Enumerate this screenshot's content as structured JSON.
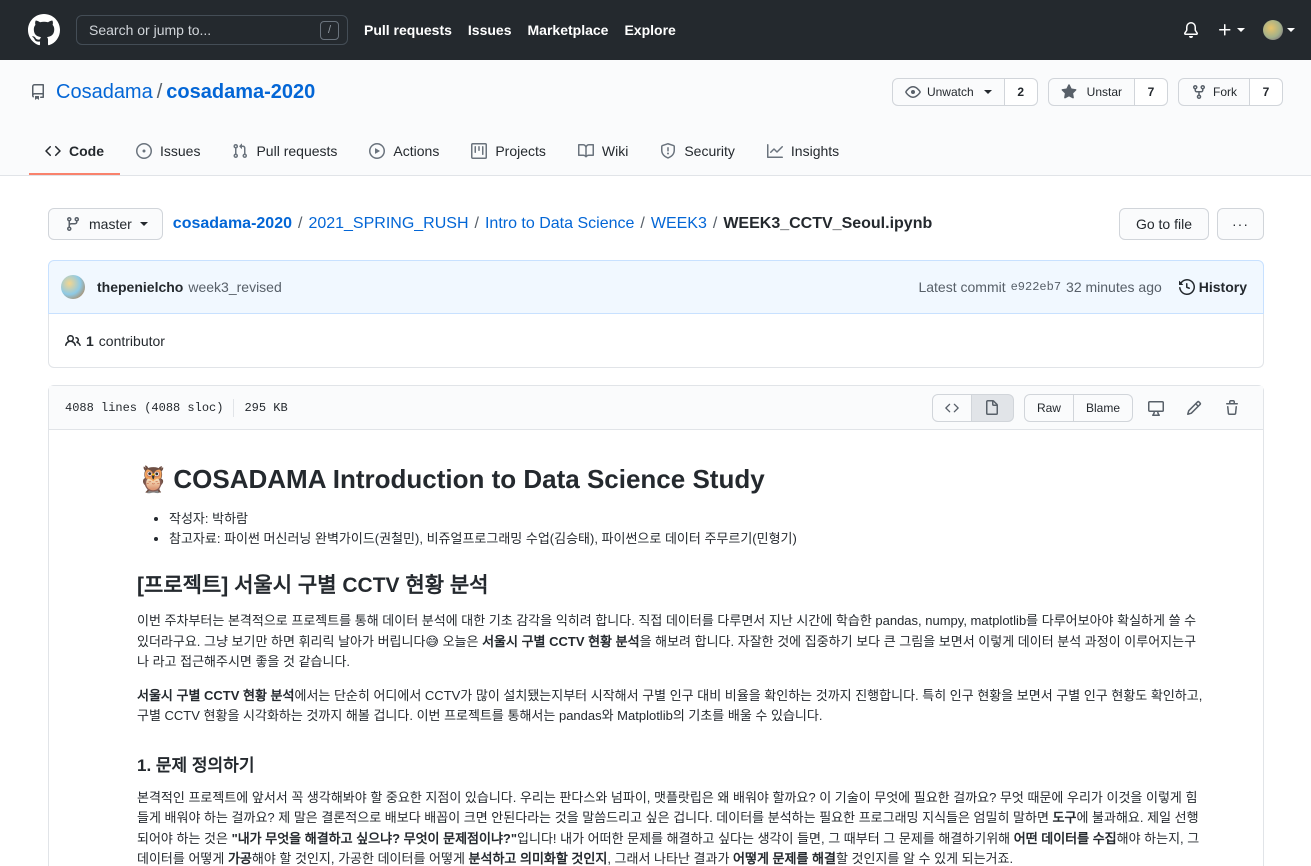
{
  "topbar": {
    "search_placeholder": "Search or jump to...",
    "search_shortcut": "/",
    "nav": [
      "Pull requests",
      "Issues",
      "Marketplace",
      "Explore"
    ]
  },
  "repo": {
    "owner": "Cosadama",
    "separator": "/",
    "name": "cosadama-2020",
    "watch_label": "Unwatch",
    "watch_count": "2",
    "star_label": "Unstar",
    "star_count": "7",
    "fork_label": "Fork",
    "fork_count": "7"
  },
  "tabs": [
    {
      "label": "Code",
      "icon": "code-icon"
    },
    {
      "label": "Issues",
      "icon": "issue-icon"
    },
    {
      "label": "Pull requests",
      "icon": "pull-request-icon"
    },
    {
      "label": "Actions",
      "icon": "play-icon"
    },
    {
      "label": "Projects",
      "icon": "project-icon"
    },
    {
      "label": "Wiki",
      "icon": "book-icon"
    },
    {
      "label": "Security",
      "icon": "shield-icon"
    },
    {
      "label": "Insights",
      "icon": "graph-icon"
    }
  ],
  "filenav": {
    "branch": "master",
    "crumbs": [
      "cosadama-2020",
      "2021_SPRING_RUSH",
      "Intro to Data Science",
      "WEEK3"
    ],
    "current_file": "WEEK3_CCTV_Seoul.ipynb",
    "goto_label": "Go to file",
    "more_label": "···"
  },
  "commit": {
    "author": "thepenielcho",
    "message": "week3_revised",
    "latest_label": "Latest commit",
    "sha": "e922eb7",
    "time": "32 minutes ago",
    "history_label": "History"
  },
  "contributors": {
    "count": "1",
    "label": "contributor"
  },
  "file": {
    "lines": "4088 lines (4088 sloc)",
    "size": "295 KB",
    "raw_label": "Raw",
    "blame_label": "Blame"
  },
  "notebook": {
    "title_emoji": "🦉",
    "title": "COSADAMA Introduction to Data Science Study",
    "meta": [
      "작성자: 박하람",
      "참고자료: 파이썬 머신러닝 완벽가이드(권철민), 비쥬얼프로그래밍 수업(김승태), 파이썬으로 데이터 주무르기(민형기)"
    ],
    "project_heading": "[프로젝트] 서울시 구별 CCTV 현황 분석",
    "p1_a": "이번 주차부터는 본격적으로 프로젝트를 통해 데이터 분석에 대한 기초 감각을 익히려 합니다. 직접 데이터를 다루면서 지난 시간에 학습한 pandas, numpy, matplotlib를 다루어보아야 확실하게 쓸 수 있더라구요. 그냥 보기만 하면 휘리릭 날아가 버립니다",
    "p1_emoji": "😅",
    "p1_b": " 오늘은 ",
    "p1_bold": "서울시 구별 CCTV 현황 분석",
    "p1_c": "을 해보려 합니다. 자잘한 것에 집중하기 보다 큰 그림을 보면서 이렇게 데이터 분석 과정이 이루어지는구나 라고 접근해주시면 좋을 것 같습니다.",
    "p2_bold": "서울시 구별 CCTV 현황 분석",
    "p2_a": "에서는 단순히 어디에서 CCTV가 많이 설치됐는지부터 시작해서 구별 인구 대비 비율을 확인하는 것까지 진행합니다. 특히 인구 현황을 보면서 구별 인구 현황도 확인하고, 구별 CCTV 현황을 시각화하는 것까지 해볼 겁니다. 이번 프로젝트를 통해서는 pandas와 Matplotlib의 기초를 배울 수 있습니다.",
    "section1": "1. 문제 정의하기",
    "p3_a": "본격적인 프로젝트에 앞서서 꼭 생각해봐야 할 중요한 지점이 있습니다. 우리는 판다스와 넘파이, 맷플랏립은 왜 배워야 할까요? 이 기술이 무엇에 필요한 걸까요? 무엇 때문에 우리가 이것을 이렇게 힘들게 배워야 하는 걸까요? 제 말은 결론적으로 배보다 배꼽이 크면 안된다라는 것을 말씀드리고 싶은 겁니다. 데이터를 분석하는 필요한 프로그래밍 지식들은 엄밀히 말하면 ",
    "p3_b1": "도구",
    "p3_b": "에 불과해요. 제일 선행되어야 하는 것은 ",
    "p3_b2": "\"내가 무엇을 해결하고 싶으냐? 무엇이 문제점이냐?\"",
    "p3_c": "입니다! 내가 어떠한 문제를 해결하고 싶다는 생각이 들면, 그 때부터 그 문제를 해결하기위해 ",
    "p3_b3": "어떤 데이터를 수집",
    "p3_d": "해야 하는지, 그 데이터를 어떻게 ",
    "p3_b4": "가공",
    "p3_e": "해야 할 것인지, 가공한 데이터를 어떻게 ",
    "p3_b5": "분석하고 의미화할 것인지",
    "p3_f": ", 그래서 나타난 결과가 ",
    "p3_b6": "어떻게 문제를 해결",
    "p3_g": "할 것인지를 알 수 있게 되는거죠."
  }
}
